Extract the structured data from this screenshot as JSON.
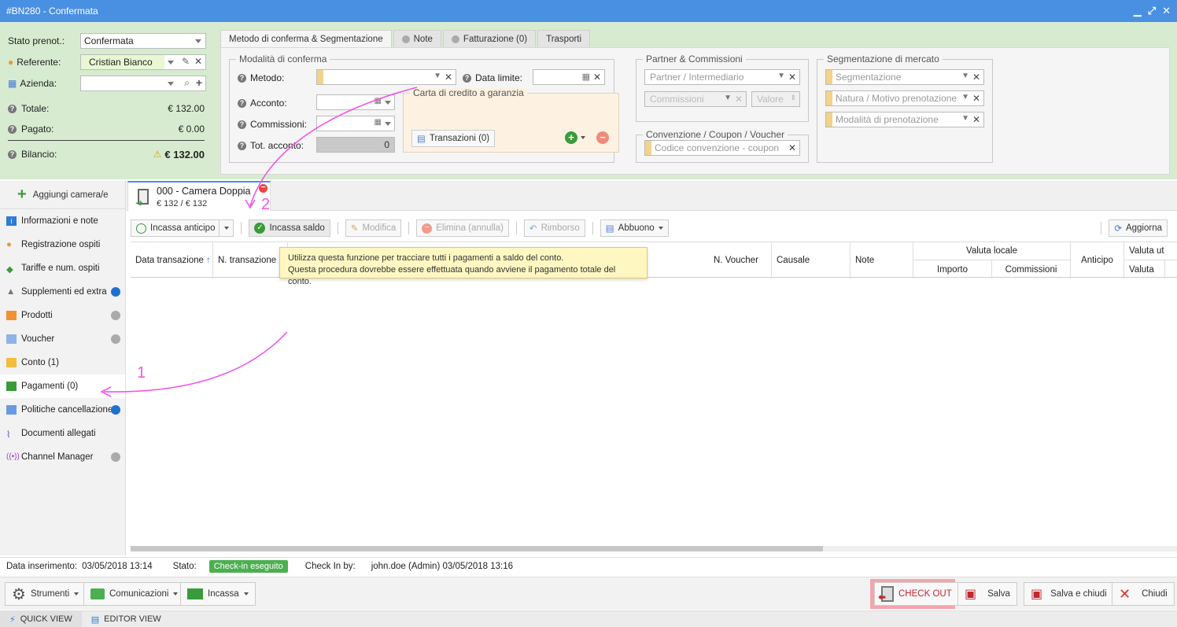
{
  "window": {
    "title": "#BN280 - Confermata"
  },
  "left_info": {
    "stato_label": "Stato prenot.:",
    "stato_value": "Confermata",
    "referente_label": "Referente:",
    "referente_value": "Cristian Bianco",
    "azienda_label": "Azienda:",
    "azienda_value": "",
    "totale_label": "Totale:",
    "totale_value": "€ 132.00",
    "pagato_label": "Pagato:",
    "pagato_value": "€ 0.00",
    "bilancio_label": "Bilancio:",
    "bilancio_value": "€ 132.00"
  },
  "tabs": [
    {
      "label": "Metodo di conferma & Segmentazione"
    },
    {
      "label": "Note"
    },
    {
      "label": "Fatturazione (0)"
    },
    {
      "label": "Trasporti"
    }
  ],
  "conferma": {
    "group_title": "Modalità di conferma",
    "metodo_label": "Metodo:",
    "data_limite_label": "Data limite:",
    "acconto_label": "Acconto:",
    "commissioni_label": "Commissioni:",
    "tot_acconto_label": "Tot. acconto:",
    "tot_acconto_value": "0",
    "carta_title": "Carta di credito a garanzia",
    "transazioni_label": "Transazioni (0)"
  },
  "partner": {
    "group_title": "Partner & Commissioni",
    "partner_placeholder": "Partner / Intermediario",
    "commissioni_placeholder": "Commissioni",
    "valore_placeholder": "Valore",
    "conv_title": "Convenzione / Coupon / Voucher",
    "conv_placeholder": "Codice convenzione - coupon"
  },
  "segmentazione": {
    "group_title": "Segmentazione di mercato",
    "seg_placeholder": "Segmentazione",
    "natura_placeholder": "Natura / Motivo prenotazione",
    "modalita_placeholder": "Modalità di prenotazione"
  },
  "sidebar": {
    "add_label": "Aggiungi camera/e",
    "items": [
      {
        "label": "Informazioni e note"
      },
      {
        "label": "Registrazione ospiti"
      },
      {
        "label": "Tariffe e num. ospiti"
      },
      {
        "label": "Supplementi ed extra"
      },
      {
        "label": "Prodotti"
      },
      {
        "label": "Voucher"
      },
      {
        "label": "Conto (1)"
      },
      {
        "label": "Pagamenti (0)"
      },
      {
        "label": "Politiche cancellazione"
      },
      {
        "label": "Documenti allegati"
      },
      {
        "label": "Channel Manager"
      }
    ]
  },
  "room": {
    "name": "000 - Camera Doppia",
    "price": "€ 132 / € 132"
  },
  "toolbar": {
    "incassa_anticipo": "Incassa anticipo",
    "incassa_saldo": "Incassa saldo",
    "modifica": "Modifica",
    "elimina": "Elimina (annulla)",
    "rimborso": "Rimborso",
    "abbuono": "Abbuono",
    "aggiorna": "Aggiorna"
  },
  "grid": {
    "data_transazione": "Data transazione",
    "n_transazione": "N. transazione",
    "n_voucher": "N. Voucher",
    "causale": "Causale",
    "note": "Note",
    "valuta_locale": "Valuta locale",
    "importo": "Importo",
    "commissioni": "Commissioni",
    "anticipo": "Anticipo",
    "valuta_ut": "Valuta ut",
    "valuta": "Valuta"
  },
  "tooltip": {
    "line1": "Utilizza questa funzione per tracciare tutti i pagamenti a saldo del conto.",
    "line2": "Questa procedura dovrebbe essere effettuata quando avviene il pagamento totale del conto."
  },
  "annotations": {
    "n1": "1",
    "n2": "2"
  },
  "status": {
    "inserimento_label": "Data inserimento:",
    "inserimento_value": "03/05/2018 13:14",
    "stato_label": "Stato:",
    "stato_badge": "Check-in eseguito",
    "checkin_label": "Check In by:",
    "checkin_value": "john.doe (Admin) 03/05/2018 13:16"
  },
  "bottom": {
    "strumenti": "Strumenti",
    "comunicazioni": "Comunicazioni",
    "incassa": "Incassa",
    "checkout": "CHECK OUT",
    "salva": "Salva",
    "salva_chiudi": "Salva e chiudi",
    "chiudi": "Chiudi"
  },
  "views": {
    "quick": "QUICK VIEW",
    "editor": "EDITOR VIEW"
  },
  "colors": {
    "titlebar": "#4a90e2",
    "top_bg": "#d7ebd0",
    "annotation": "#f055e6",
    "checkout_highlight": "#f3a5ad"
  }
}
